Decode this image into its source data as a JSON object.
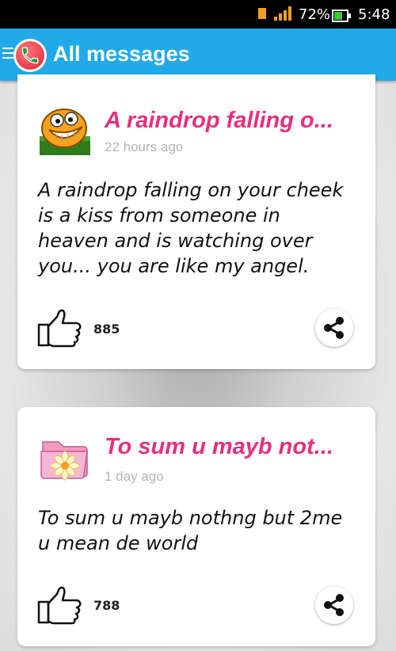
{
  "status_bar": {
    "battery_percent": "72%",
    "time": "5:48"
  },
  "app_bar": {
    "title": "All messages"
  },
  "messages": [
    {
      "title": "A raindrop falling o...",
      "time_ago": "22 hours ago",
      "body_lines": [
        "A raindrop falling on your cheek",
        "is a kiss from someone in",
        "heaven and is watching over",
        "you... you are like my angel."
      ],
      "likes": "885",
      "avatar_icon": "grinning-emoticon-icon"
    },
    {
      "title": "To sum u mayb not...",
      "time_ago": "1 day ago",
      "body_lines": [
        "To sum u mayb nothng but 2me",
        "u mean de world"
      ],
      "likes": "788",
      "avatar_icon": "pink-folder-flower-icon"
    }
  ],
  "colors": {
    "app_bar": "#21a9e8",
    "title_pink": "#e5307d",
    "time_gray": "#b5b5b5"
  }
}
